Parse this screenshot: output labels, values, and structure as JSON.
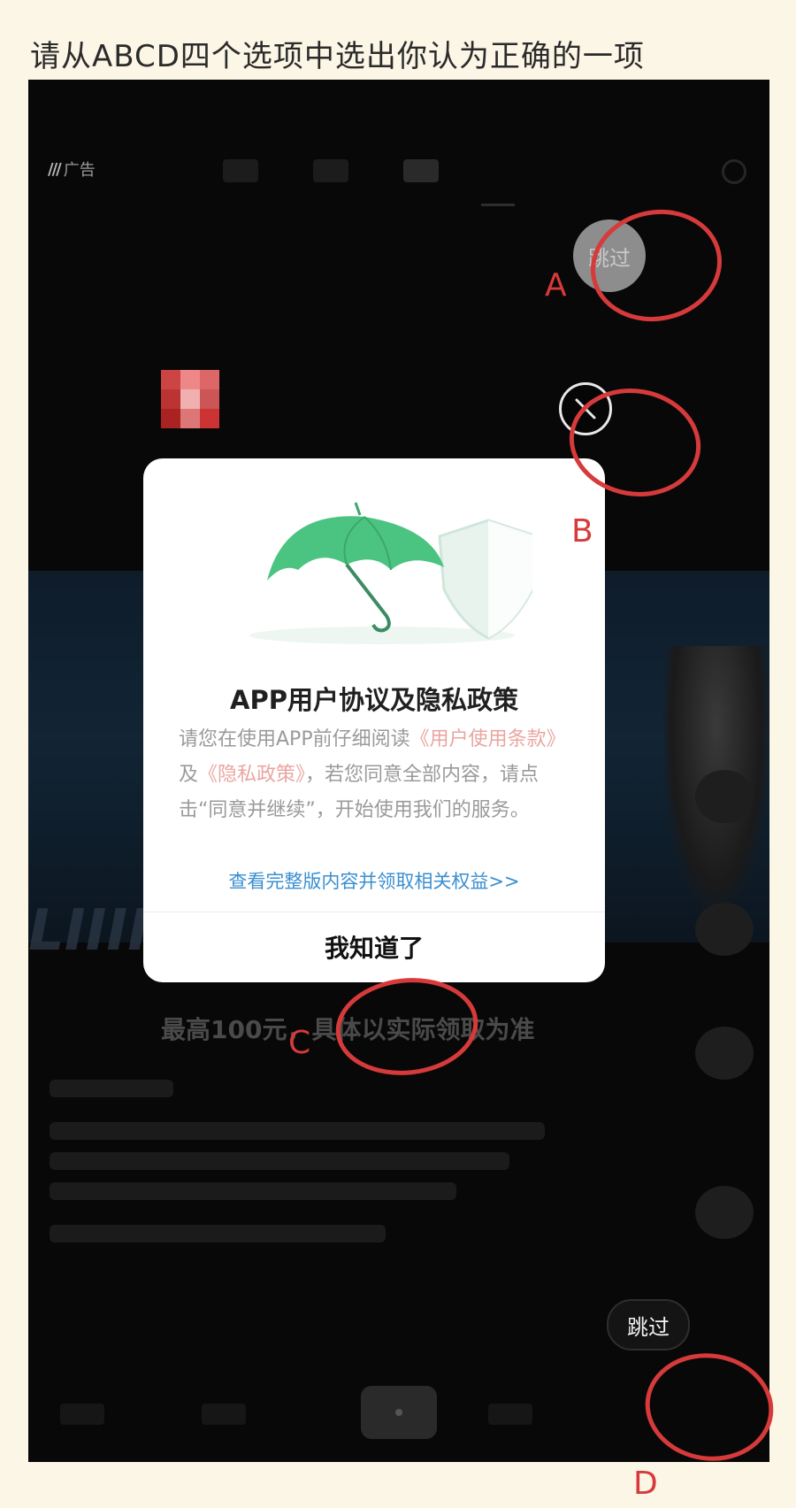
{
  "question": "请从ABCD四个选项中选出你认为正确的一项",
  "ad": {
    "label": "广告"
  },
  "options": {
    "a": {
      "label": "A",
      "button": "跳过"
    },
    "b": {
      "label": "B"
    },
    "c": {
      "label": "C"
    },
    "d": {
      "label": "D",
      "button": "跳过"
    }
  },
  "dialog": {
    "title": "APP用户协议及隐私政策",
    "body_before": "请您在使用APP前仔细阅读",
    "link_terms": "《用户使用条款》",
    "body_and": "及",
    "link_privacy": "《隐私政策》",
    "body_after": "，若您同意全部内容，请点击“同意并继续”，开始使用我们的服务。",
    "more_link": "查看完整版内容并领取相关权益>>",
    "ok_button": "我知道了"
  },
  "promo": "最高100元，具体以实际领取为准",
  "colors": {
    "annotation_red": "#d63a3a",
    "dialog_link_blue": "#3a8fd0",
    "umbrella_green": "#4cc481"
  },
  "icons": [
    "close-icon",
    "umbrella-icon",
    "shield-icon"
  ]
}
